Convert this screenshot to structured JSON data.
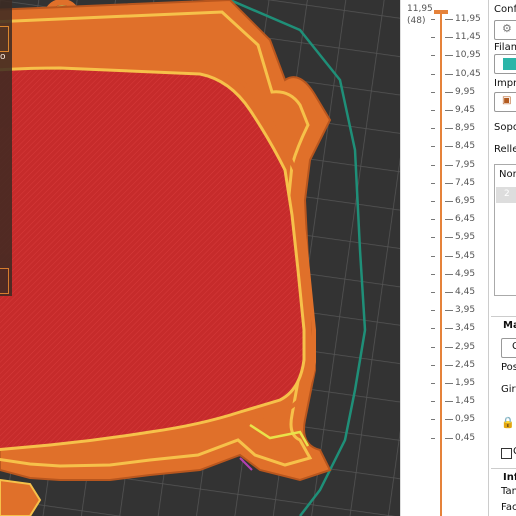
{
  "viewport": {
    "left_label": "o"
  },
  "ruler": {
    "top_value": "11,95",
    "top_layer": "(48)",
    "ticks": [
      "11,95",
      "11,45",
      "10,95",
      "10,45",
      "9,95",
      "9,45",
      "8,95",
      "8,45",
      "7,95",
      "7,45",
      "6,95",
      "6,45",
      "5,95",
      "5,45",
      "4,95",
      "4,45",
      "3,95",
      "3,45",
      "2,95",
      "2,45",
      "1,95",
      "1,45",
      "0,95",
      "0,45"
    ]
  },
  "panel": {
    "config_label": "Conf",
    "filament_label": "Filam",
    "printer_label": "Impre",
    "supports_label": "Sopo",
    "infill_label": "Relle",
    "table_header": "Non",
    "table_row": "2",
    "manip_title": "Ma",
    "manip_button": "C",
    "position_label": "Pos",
    "rotate_label": "Gira",
    "lock_checkbox_label": "C",
    "info_title": "Info",
    "size_label": "Tam",
    "faces_label": "Face"
  },
  "colors": {
    "accent": "#e5823a",
    "filament": "#2bb5a8",
    "model_fill": "#c62b2b",
    "wall": "#e0702a"
  }
}
